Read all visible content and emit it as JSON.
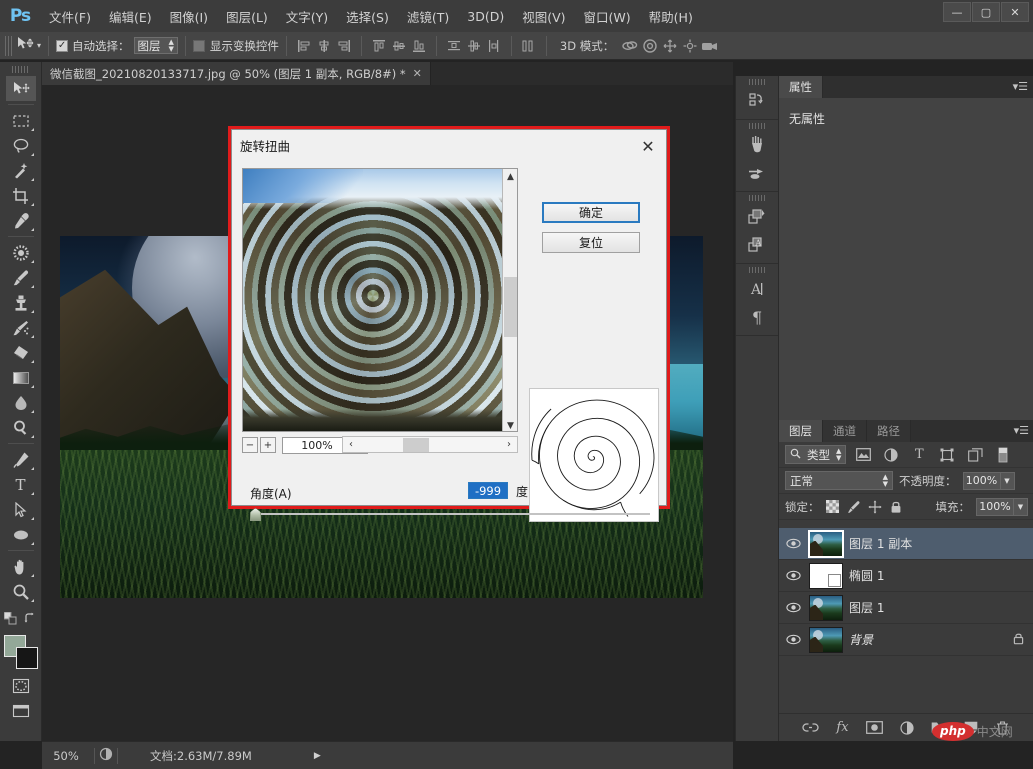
{
  "app": {
    "logo": "Ps",
    "menus": [
      "文件(F)",
      "编辑(E)",
      "图像(I)",
      "图层(L)",
      "文字(Y)",
      "选择(S)",
      "滤镜(T)",
      "3D(D)",
      "视图(V)",
      "窗口(W)",
      "帮助(H)"
    ],
    "window_buttons": {
      "minimize": "—",
      "maximize": "▢",
      "close": "✕"
    }
  },
  "options_bar": {
    "tool_icon": "move-tool-icon",
    "auto_select_label": "自动选择：",
    "auto_select_checked": true,
    "auto_select_value": "图层",
    "show_transform_label": "显示变换控件",
    "show_transform_checked": false,
    "mode3d_label": "3D 模式："
  },
  "document_tab": {
    "title": "微信截图_20210820133717.jpg @ 50% (图层 1 副本, RGB/8#) *",
    "close": "✕"
  },
  "toolbar": {
    "tools": [
      "move-tool-icon",
      "rectangular-marquee-icon",
      "lasso-icon",
      "magic-wand-icon",
      "crop-icon",
      "eyedropper-icon",
      "healing-brush-icon",
      "brush-icon",
      "clone-stamp-icon",
      "history-brush-icon",
      "eraser-icon",
      "gradient-icon",
      "blur-icon",
      "dodge-icon",
      "pen-icon",
      "type-icon",
      "path-selection-icon",
      "ellipse-shape-icon",
      "hand-icon",
      "zoom-icon"
    ],
    "foreground_color": "#93a898",
    "background_color": "#161616",
    "quick_mask_icon": "quick-mask-icon",
    "screen_mode_icon": "screen-mode-icon"
  },
  "status_bar": {
    "zoom": "50%",
    "doc_label": "文档:2.63M/7.89M",
    "arrow": "▶"
  },
  "icon_dock": {
    "icons": [
      "history-icon",
      "brush-preset-icon",
      "brush-tip-icon",
      "layer-comps-icon",
      "adjustments-icon",
      "character-icon",
      "paragraph-icon"
    ]
  },
  "properties_panel": {
    "tab": "属性",
    "empty_text": "无属性",
    "menu_icon": "panel-menu-icon"
  },
  "layers_panel": {
    "tabs": [
      "图层",
      "通道",
      "路径"
    ],
    "active_tab": "图层",
    "filter_label": "类型",
    "filter_icons": [
      "filter-image-icon",
      "filter-adjustment-icon",
      "filter-type-icon",
      "filter-shape-icon",
      "filter-smart-icon"
    ],
    "blend_mode": "正常",
    "opacity_label": "不透明度：",
    "opacity_value": "100%",
    "lock_label": "锁定：",
    "lock_icons": [
      "lock-transparent-icon",
      "lock-image-icon",
      "lock-position-icon",
      "lock-all-icon"
    ],
    "fill_label": "填充：",
    "fill_value": "100%",
    "layers": [
      {
        "name": "图层 1 副本",
        "thumb": "photo",
        "selected": true,
        "locked": false,
        "visible": true
      },
      {
        "name": "椭圆 1",
        "thumb": "white",
        "selected": false,
        "locked": false,
        "visible": true
      },
      {
        "name": "图层 1",
        "thumb": "photo",
        "selected": false,
        "locked": false,
        "visible": true
      },
      {
        "name": "背景",
        "thumb": "photo",
        "selected": false,
        "locked": true,
        "visible": true
      }
    ],
    "bottom_icons": [
      "link-layers-icon",
      "layer-style-fx-icon",
      "add-mask-icon",
      "adjustment-layer-icon",
      "new-group-icon",
      "new-layer-icon",
      "delete-layer-icon"
    ]
  },
  "dialog": {
    "title": "旋转扭曲",
    "close": "✕",
    "ok_label": "确定",
    "reset_label": "复位",
    "zoom_out": "−",
    "zoom_in": "+",
    "zoom_value": "100%",
    "scroll_left": "‹",
    "scroll_right": "›",
    "angle_label": "角度(A)",
    "angle_value": "-999",
    "angle_unit": "度",
    "highlight_color": "#e01b1b",
    "accent_color": "#2a7ac0"
  },
  "watermark": {
    "brand": "php",
    "suffix": "中文网"
  }
}
